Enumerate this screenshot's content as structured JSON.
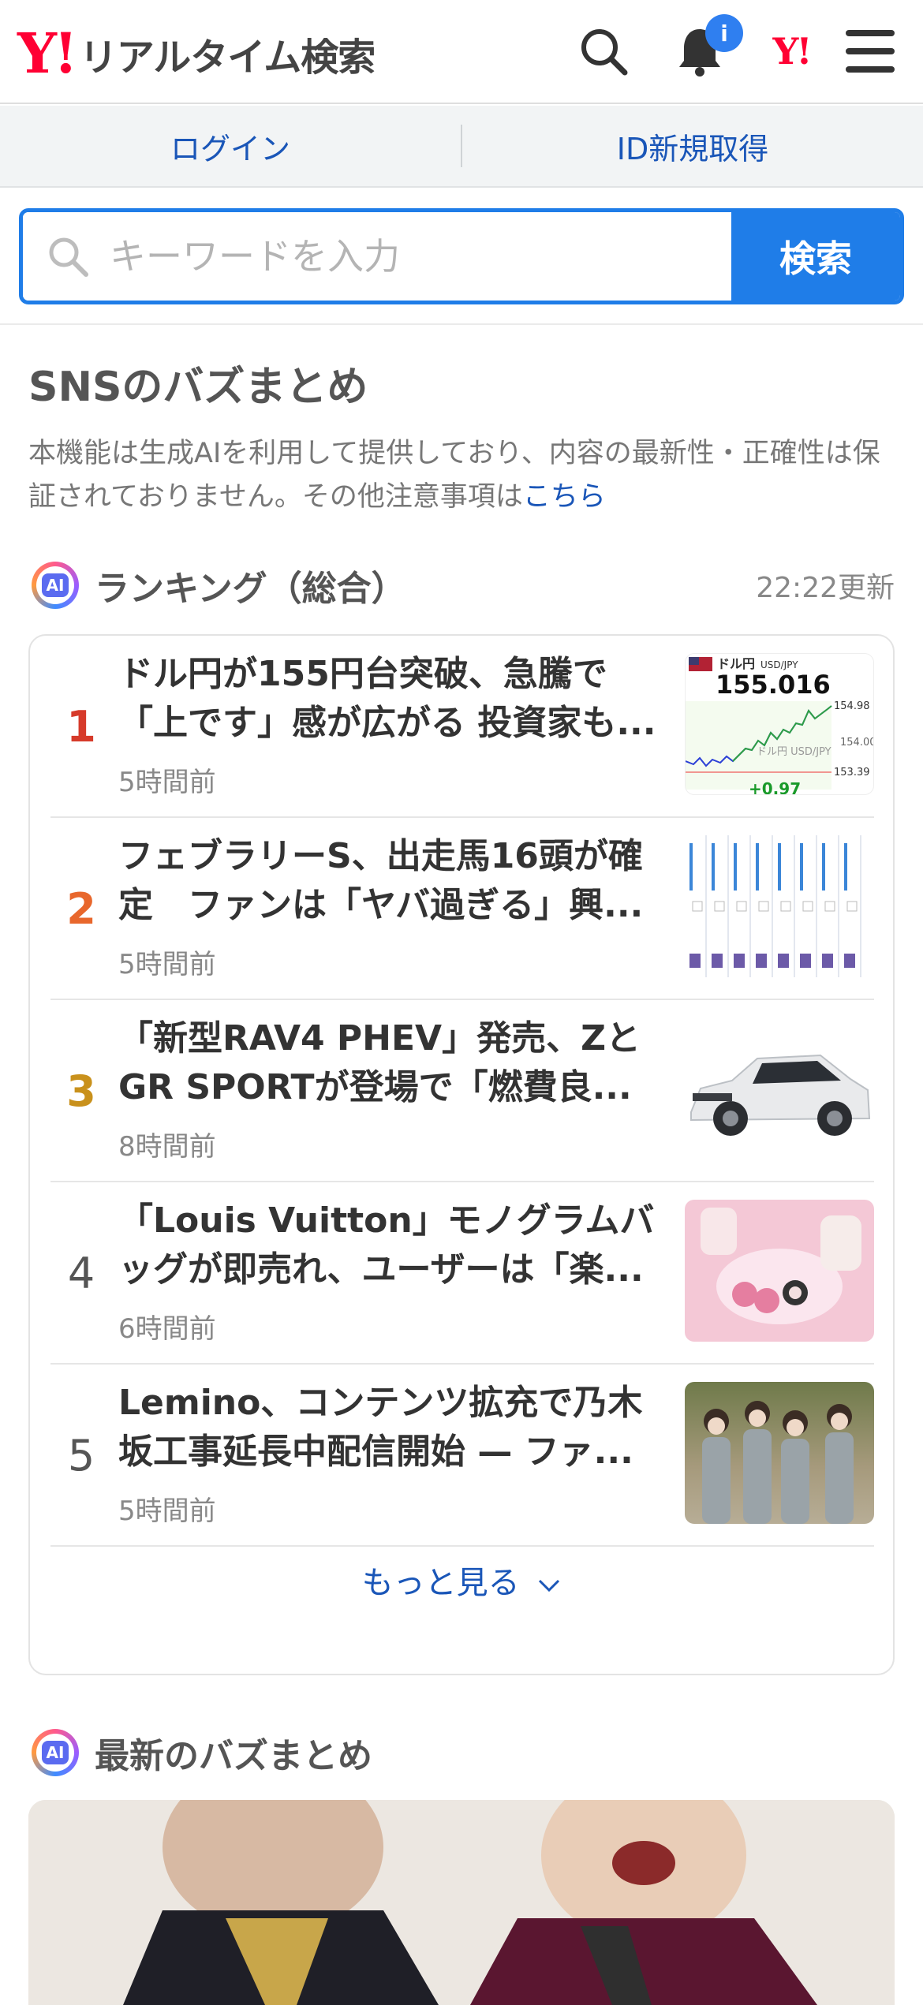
{
  "header": {
    "logo_mark": "Y!",
    "logo_text": "リアルタイム検索",
    "notification_badge": "i",
    "yahoo_icon_text": "Y!"
  },
  "auth": {
    "login_label": "ログイン",
    "register_label": "ID新規取得"
  },
  "search": {
    "placeholder": "キーワードを入力",
    "button_label": "検索"
  },
  "buzz": {
    "title": "SNSのバズまとめ",
    "disclaimer": "本機能は生成AIを利用して提供しており、内容の最新性・正確性は保証されておりません。その他注意事項は",
    "disclaimer_link": "こちら"
  },
  "ranking": {
    "ai_badge": "AI",
    "title": "ランキング（総合）",
    "updated": "22:22更新",
    "items": [
      {
        "rank": "1",
        "rank_color": "#d63a2a",
        "title": "ドル円が155円台突破、急騰で「上です」感が広がる 投資家も...",
        "time": "5時間前",
        "thumb": "usdjpy-chart"
      },
      {
        "rank": "2",
        "rank_color": "#e8672c",
        "title": "フェブラリーS、出走馬16頭が確定　ファンは「ヤバ過ぎる」興...",
        "time": "5時間前",
        "thumb": "race-entry-table"
      },
      {
        "rank": "3",
        "rank_color": "#c9911c",
        "title": "「新型RAV4 PHEV」発売、Zと GR SPORTが登場で「燃費良...",
        "time": "8時間前",
        "thumb": "suv-car-photo"
      },
      {
        "rank": "4",
        "rank_color": "#555555",
        "title": "「Louis Vuitton」モノグラムバッグが即売れ、ユーザーは「楽...",
        "time": "6時間前",
        "thumb": "pink-tableware-photo"
      },
      {
        "rank": "5",
        "rank_color": "#555555",
        "title": "Lemino、コンテンツ拡充で乃木坂工事延長中配信開始 — ファ...",
        "time": "5時間前",
        "thumb": "group-photo"
      }
    ],
    "more_label": "もっと見る",
    "chart_thumb": {
      "pair_label": "ドル円",
      "pair_code": "USD/JPY",
      "price": "155.016",
      "levels": [
        "154.98",
        "154.00",
        "153.39"
      ],
      "watermark": "ドル円 USD/JPY",
      "change": "+0.97"
    }
  },
  "latest": {
    "ai_badge": "AI",
    "title": "最新のバズまとめ"
  }
}
